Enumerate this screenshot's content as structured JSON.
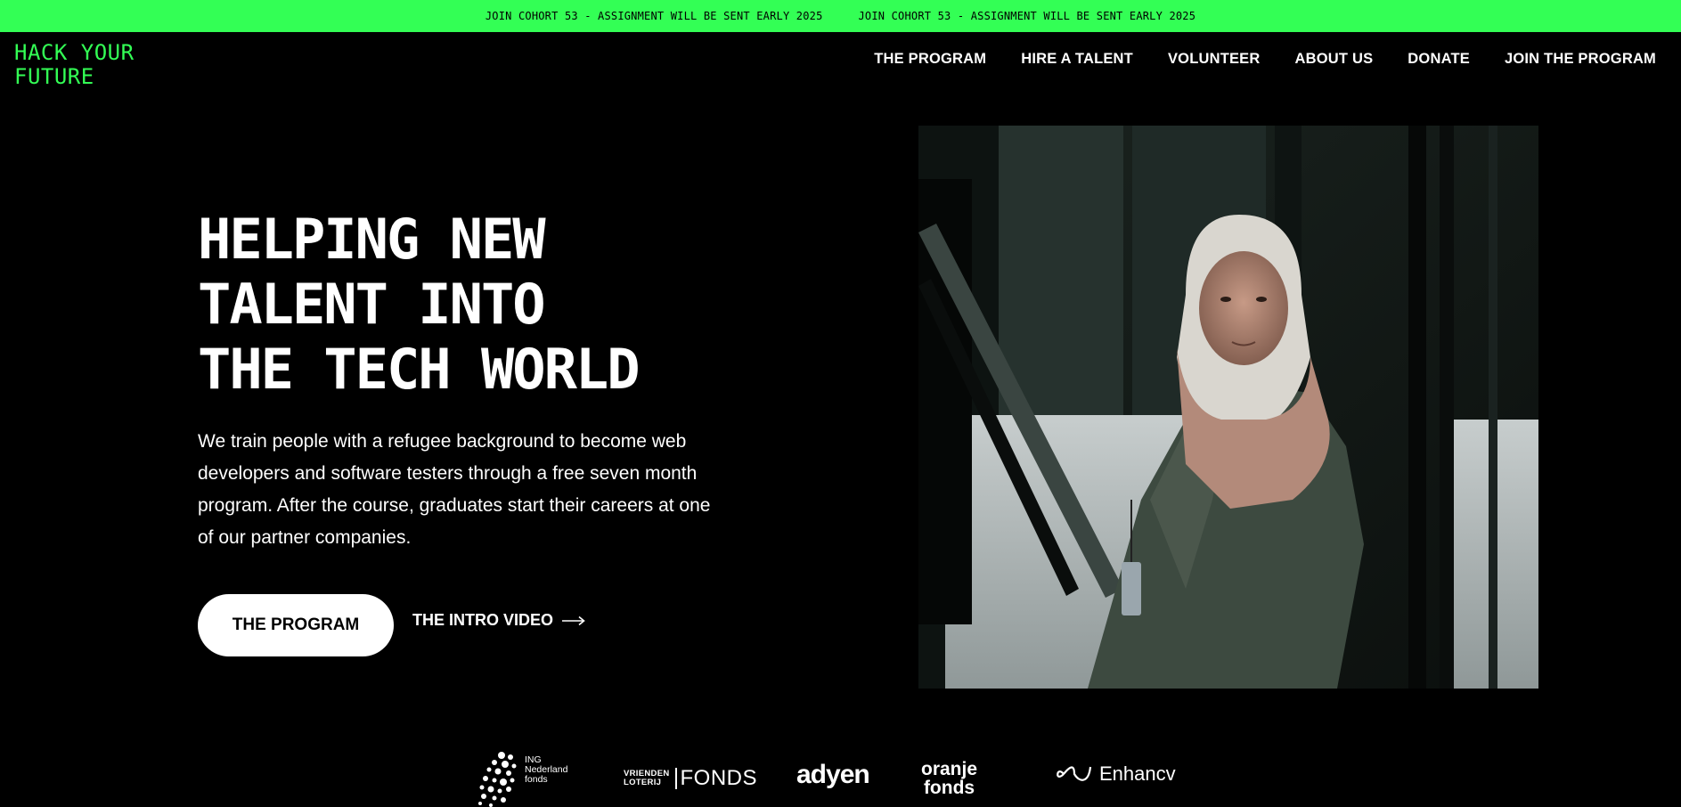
{
  "banner": {
    "messages": [
      "JOIN COHORT 53 - ASSIGNMENT WILL BE SENT EARLY 2025",
      "JOIN COHORT 53 - ASSIGNMENT WILL BE SENT EARLY 2025"
    ],
    "color": "#33ff55"
  },
  "logo": {
    "line1": "HACK YOUR",
    "line2": "FUTURE"
  },
  "nav": {
    "items": [
      {
        "label": "THE PROGRAM"
      },
      {
        "label": "HIRE A TALENT"
      },
      {
        "label": "VOLUNTEER"
      },
      {
        "label": "ABOUT US"
      },
      {
        "label": "DONATE"
      },
      {
        "label": "JOIN THE PROGRAM"
      }
    ]
  },
  "hero": {
    "title_lines": [
      "HELPING NEW",
      "TALENT INTO",
      "THE TECH WORLD"
    ],
    "description": "We train people with a refugee background to become web developers and software testers through a free seven month program. After the course, graduates start their careers at one of our partner companies.",
    "primary_button": "THE PROGRAM",
    "video_link": "THE INTRO VIDEO"
  },
  "sponsors": {
    "ing": [
      "ING",
      "Nederland",
      "fonds"
    ],
    "vriendenloterij": {
      "line1": "VRIENDEN",
      "line2": "LOTERIJ",
      "fonds": "FONDS"
    },
    "adyen": "adyen",
    "oranje": [
      "oranje",
      "fonds"
    ],
    "enhancv": "Enhancv"
  },
  "icons": {
    "arrow": "arrow-right-icon",
    "sponsor_marks": [
      "ing-dots-icon",
      "enhancv-infinity-icon"
    ]
  }
}
